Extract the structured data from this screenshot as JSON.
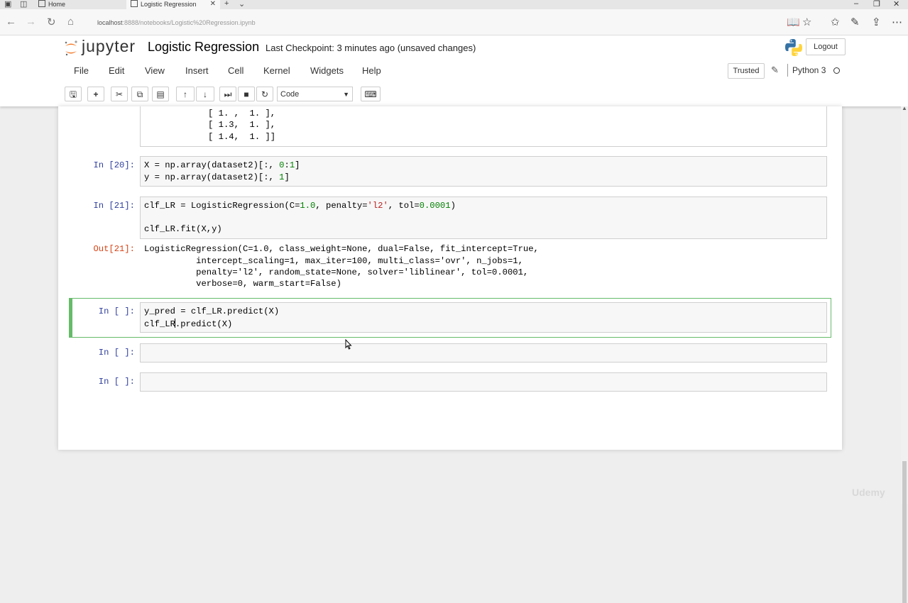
{
  "browser": {
    "tabs": [
      {
        "title": "Home"
      },
      {
        "title": "Logistic Regression"
      }
    ],
    "url_host": "localhost",
    "url_rest": ":8888/notebooks/Logistic%20Regression.ipynb"
  },
  "header": {
    "logo_text": "jupyter",
    "notebook_title": "Logistic Regression",
    "checkpoint": "Last Checkpoint: 3 minutes ago (unsaved changes)",
    "logout": "Logout",
    "trusted": "Trusted",
    "kernel": "Python 3"
  },
  "menu": [
    "File",
    "Edit",
    "View",
    "Insert",
    "Cell",
    "Kernel",
    "Widgets",
    "Help"
  ],
  "toolbar": {
    "cell_type": "Code"
  },
  "cells": {
    "output_tail": {
      "lines": [
        "[ 1. ,  1. ],",
        "[ 1.3,  1. ],",
        "[ 1.4,  1. ]]"
      ]
    },
    "c20": {
      "prompt": "In [20]:",
      "lines": [
        "X = np.array(dataset2)[:, 0:1]",
        "y = np.array(dataset2)[:, 1]"
      ]
    },
    "c21": {
      "prompt": "In [21]:",
      "lines": [
        "clf_LR = LogisticRegression(C=1.0, penalty='l2', tol=0.0001)",
        "",
        "clf_LR.fit(X,y)"
      ],
      "out_prompt": "Out[21]:",
      "out_lines": [
        "LogisticRegression(C=1.0, class_weight=None, dual=False, fit_intercept=True,",
        "          intercept_scaling=1, max_iter=100, multi_class='ovr', n_jobs=1,",
        "          penalty='l2', random_state=None, solver='liblinear', tol=0.0001,",
        "          verbose=0, warm_start=False)"
      ]
    },
    "active": {
      "prompt": "In [ ]:",
      "line1": "y_pred = clf_LR.predict(X)",
      "line2_before": "clf_LR",
      "line2_after": ".predict(X)"
    },
    "empty1": {
      "prompt": "In [ ]:"
    },
    "empty2": {
      "prompt": "In [ ]:"
    }
  },
  "watermark": "Udemy"
}
